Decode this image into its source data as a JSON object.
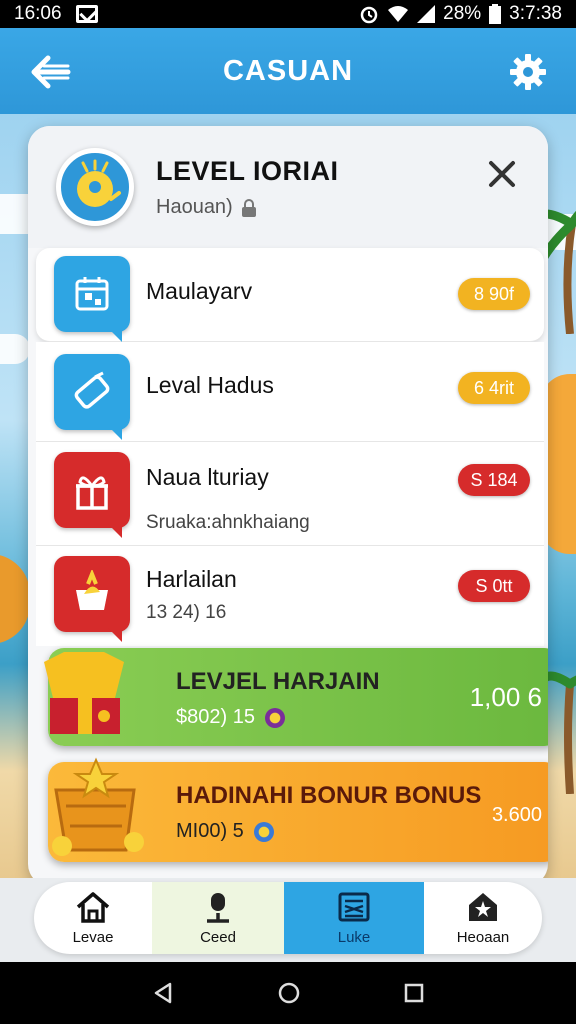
{
  "status": {
    "left_text": "16:06",
    "battery": "28%",
    "time": "3:7:38"
  },
  "header": {
    "title": "CASUAN"
  },
  "card": {
    "title": "LEVEL IORIAI",
    "subtitle": "Haouan)",
    "rows": [
      {
        "label": "Maulayarv",
        "sub": "",
        "pill": "8 90f",
        "pill_color": "#f2b321"
      },
      {
        "label": "Leval Hadus",
        "sub": "",
        "pill": "6 4rit",
        "pill_color": "#f2b321"
      },
      {
        "label": "Naua lturiay",
        "sub": "Sruaka:ahnkhaiang",
        "pill": "S 184",
        "pill_color": "#d62b2b"
      },
      {
        "label": "Harlailan",
        "sub": "13 24) 16",
        "pill": "S 0tt",
        "pill_color": "#d62b2b"
      }
    ],
    "banner_green": {
      "title": "LEVJEL HARJAIN",
      "sub": "$802) 15",
      "value": "1,00 6"
    },
    "banner_orange": {
      "title": "HADINAHI BONUR BONUS",
      "sub": "MI00) 5",
      "value": "3.600"
    }
  },
  "nav": {
    "items": [
      {
        "label": "Levae"
      },
      {
        "label": "Ceed"
      },
      {
        "label": "Luke"
      },
      {
        "label": "Heoaan"
      }
    ]
  },
  "colors": {
    "header": "#2e97d8",
    "green": "#7cc247",
    "orange": "#f6a62a",
    "red": "#d62b2b",
    "blue": "#2ea5e3"
  }
}
